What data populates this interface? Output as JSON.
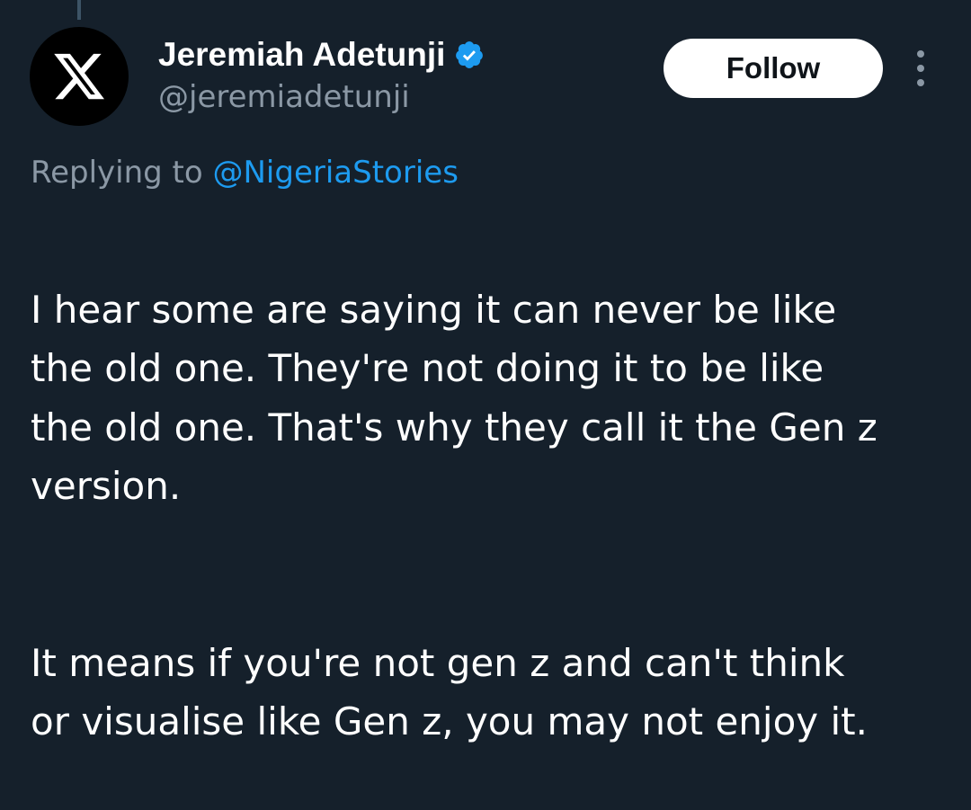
{
  "colors": {
    "background": "#15202b",
    "accent": "#1d9bf0",
    "secondary_text": "#8b98a5",
    "primary_text": "#ffffff"
  },
  "author": {
    "avatar_icon": "x-logo-icon",
    "name": "Jeremiah Adetunji",
    "verified_icon": "verified-badge-icon",
    "handle": "@jeremiadetunji"
  },
  "actions": {
    "follow_label": "Follow",
    "more_icon": "more-vertical-icon"
  },
  "reply": {
    "prefix": "Replying to",
    "mention": "@NigeriaStories"
  },
  "tweet": {
    "paragraph1": "I hear some are saying it can never be like\nthe old one. They're not doing it to be like\nthe old one. That's why they call it the Gen z\nversion.",
    "paragraph2": "It means if you're not gen z and can't think\nor visualise like Gen z, you may not enjoy it."
  }
}
